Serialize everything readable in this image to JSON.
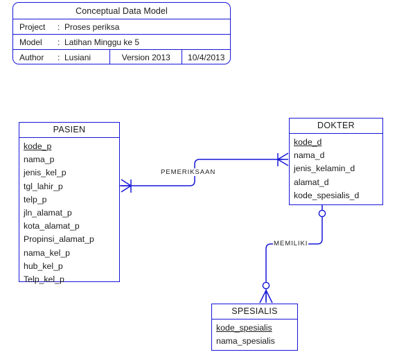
{
  "diagram": {
    "kind": "conceptual-data-model-erd",
    "accent_color": "#1515d8",
    "text_color": "#1a1a1a",
    "background_color": "#ffffff"
  },
  "title_block": {
    "title": "Conceptual Data Model",
    "rows": [
      {
        "key": "Project",
        "colon": ":",
        "value": "Proses periksa"
      },
      {
        "key": "Model",
        "colon": ":",
        "value": "Latihan Minggu ke 5"
      }
    ],
    "footer": {
      "author_key": "Author",
      "author_colon": ":",
      "author_value": "Lusiani",
      "version": "Version 2013",
      "date": "10/4/2013"
    }
  },
  "entities": [
    {
      "name": "PASIEN",
      "attributes": [
        {
          "label": "kode_p",
          "primary_key": true
        },
        {
          "label": "nama_p",
          "primary_key": false
        },
        {
          "label": "jenis_kel_p",
          "primary_key": false
        },
        {
          "label": "tgl_lahir_p",
          "primary_key": false
        },
        {
          "label": "telp_p",
          "primary_key": false
        },
        {
          "label": "jln_alamat_p",
          "primary_key": false
        },
        {
          "label": "kota_alamat_p",
          "primary_key": false
        },
        {
          "label": "Propinsi_alamat_p",
          "primary_key": false
        },
        {
          "label": "nama_kel_p",
          "primary_key": false
        },
        {
          "label": "hub_kel_p",
          "primary_key": false
        },
        {
          "label": "Telp_kel_p",
          "primary_key": false
        }
      ]
    },
    {
      "name": "DOKTER",
      "attributes": [
        {
          "label": "kode_d",
          "primary_key": true
        },
        {
          "label": "nama_d",
          "primary_key": false
        },
        {
          "label": "jenis_kelamin_d",
          "primary_key": false
        },
        {
          "label": "alamat_d",
          "primary_key": false
        },
        {
          "label": "kode_spesialis_d",
          "primary_key": false
        }
      ]
    },
    {
      "name": "SPESIALIS",
      "attributes": [
        {
          "label": "kode_spesialis",
          "primary_key": true
        },
        {
          "label": "nama_spesialis",
          "primary_key": false
        }
      ]
    }
  ],
  "relationships": [
    {
      "label": "PEMERIKSAAN",
      "from_entity": "PASIEN",
      "to_entity": "DOKTER",
      "from_cardinality": "many-mandatory",
      "to_cardinality": "many-mandatory"
    },
    {
      "label": "MEMILIKI",
      "from_entity": "DOKTER",
      "to_entity": "SPESIALIS",
      "from_cardinality": "one-optional",
      "to_cardinality": "many-optional"
    }
  ]
}
